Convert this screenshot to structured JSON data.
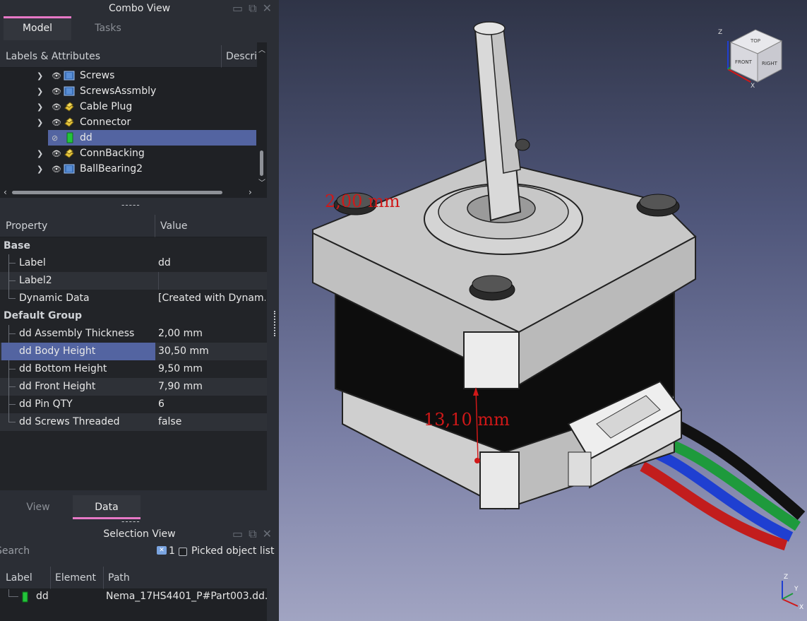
{
  "combo": {
    "title": "Combo View",
    "tabs": [
      "Model",
      "Tasks"
    ],
    "tree_header": {
      "labels": "Labels & Attributes",
      "description": "Descri"
    },
    "tree_items": [
      {
        "label": "Screws",
        "icon": "part-icon"
      },
      {
        "label": "ScrewsAssmbly",
        "icon": "part-icon"
      },
      {
        "label": "Cable Plug",
        "icon": "assembly-icon"
      },
      {
        "label": "Connector",
        "icon": "assembly-icon"
      },
      {
        "label": "dd",
        "icon": "body-icon",
        "selected": true
      },
      {
        "label": "ConnBacking",
        "icon": "assembly-icon"
      },
      {
        "label": "BallBearing2",
        "icon": "part-icon"
      }
    ],
    "splitter": "-----",
    "property_header": {
      "property": "Property",
      "value": "Value"
    },
    "groups": {
      "base": "Base",
      "default": "Default Group"
    },
    "base_props": [
      {
        "name": "Label",
        "value": "dd"
      },
      {
        "name": "Label2",
        "value": ""
      },
      {
        "name": "Dynamic Data",
        "value": "[Created with Dynam..."
      }
    ],
    "default_props": [
      {
        "name": "dd Assembly Thickness",
        "value": "2,00 mm"
      },
      {
        "name": "dd Body Height",
        "value": "30,50 mm"
      },
      {
        "name": "dd Bottom Height",
        "value": "9,50 mm"
      },
      {
        "name": "dd Front Height",
        "value": "7,90 mm"
      },
      {
        "name": "dd Pin QTY",
        "value": "6"
      },
      {
        "name": "dd Screws Threaded",
        "value": "false"
      }
    ],
    "bottom_tabs": [
      "View",
      "Data"
    ]
  },
  "selection": {
    "title": "Selection View",
    "splitter": "-----",
    "search_placeholder": "Search",
    "count": "1",
    "picked_label": "Picked object list",
    "columns": [
      "Label",
      "Element",
      "Path"
    ],
    "row": {
      "label": "dd",
      "element": "",
      "path": "Nema_17HS4401_P#Part003.dd."
    }
  },
  "viewport": {
    "dim1": "2,00  mm",
    "dim2": "13,10  mm",
    "navcube": {
      "top": "TOP",
      "front": "FRONT",
      "right": "RIGHT"
    },
    "axes": {
      "x": "X",
      "y": "Y",
      "z": "Z"
    }
  },
  "colors": {
    "accent": "#e678c6",
    "selection": "#5364a1",
    "dimension": "#d01818"
  }
}
